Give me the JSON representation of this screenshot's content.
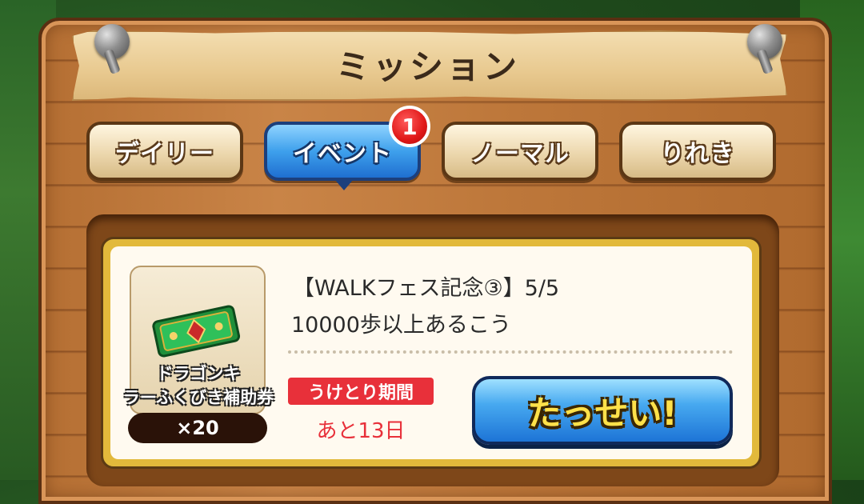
{
  "header": {
    "title": "ミッション"
  },
  "tabs": [
    {
      "label": "デイリー",
      "active": false
    },
    {
      "label": "イベント",
      "active": true,
      "badge": "1"
    },
    {
      "label": "ノーマル",
      "active": false
    },
    {
      "label": "りれき",
      "active": false
    }
  ],
  "mission": {
    "title": "【WALKフェス記念③】5/5",
    "description": "10000歩以上あるこう",
    "reward": {
      "name_line1": "ドラゴンキ",
      "name_line2": "ラーふくびき補助券",
      "quantity": "×20",
      "icon": "ticket-icon"
    },
    "period_label": "うけとり期間",
    "remaining": "あと13日",
    "achieve_button": "たっせい!"
  },
  "colors": {
    "active_tab": "#3ea0ec",
    "badge": "#e01818",
    "period_label_bg": "#e8303a",
    "button_text": "#ffe14a"
  }
}
